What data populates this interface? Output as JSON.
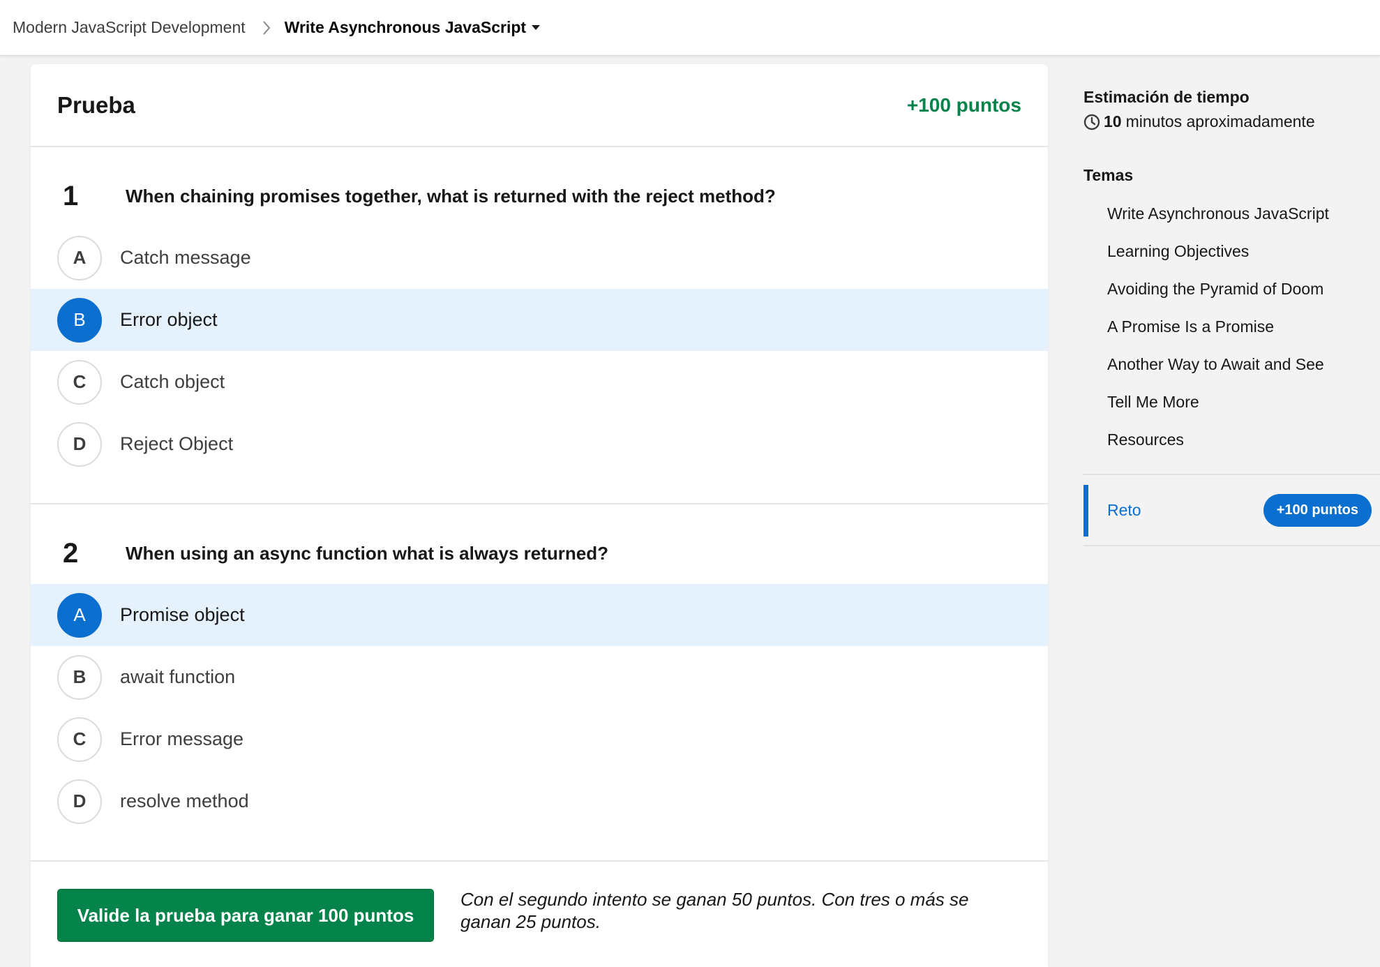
{
  "breadcrumb": {
    "parent": "Modern JavaScript Development",
    "current": "Write Asynchronous JavaScript"
  },
  "quiz": {
    "title": "Prueba",
    "points": "+100 puntos",
    "questions": [
      {
        "number": "1",
        "text": "When chaining promises together, what is returned with the reject method?",
        "options": [
          {
            "letter": "A",
            "label": "Catch message",
            "selected": false
          },
          {
            "letter": "B",
            "label": "Error object",
            "selected": true
          },
          {
            "letter": "C",
            "label": "Catch object",
            "selected": false
          },
          {
            "letter": "D",
            "label": "Reject Object",
            "selected": false
          }
        ]
      },
      {
        "number": "2",
        "text": "When using an async function what is always returned?",
        "options": [
          {
            "letter": "A",
            "label": "Promise object",
            "selected": true
          },
          {
            "letter": "B",
            "label": "await function",
            "selected": false
          },
          {
            "letter": "C",
            "label": "Error message",
            "selected": false
          },
          {
            "letter": "D",
            "label": "resolve method",
            "selected": false
          }
        ]
      }
    ],
    "submit_label": "Valide la prueba para ganar 100 puntos",
    "note": "Con el segundo intento se ganan 50 puntos. Con tres o más se ganan 25 puntos."
  },
  "sidebar": {
    "estimate_title": "Estimación de tiempo",
    "estimate_value": "10",
    "estimate_text": "minutos aproximadamente",
    "topics_title": "Temas",
    "topics": [
      "Write Asynchronous JavaScript",
      "Learning Objectives",
      "Avoiding the Pyramid of Doom",
      "A Promise Is a Promise",
      "Another Way to Await and See",
      "Tell Me More",
      "Resources"
    ],
    "challenge_label": "Reto",
    "challenge_points": "+100 puntos"
  },
  "icons": {
    "breadcrumb_separator": "chevron-right-icon",
    "breadcrumb_dropdown": "caret-down-icon",
    "estimate": "clock-icon"
  },
  "colors": {
    "accent_blue": "#0b6fcf",
    "success_green": "#04844b",
    "selected_row": "#e5f2fd"
  }
}
